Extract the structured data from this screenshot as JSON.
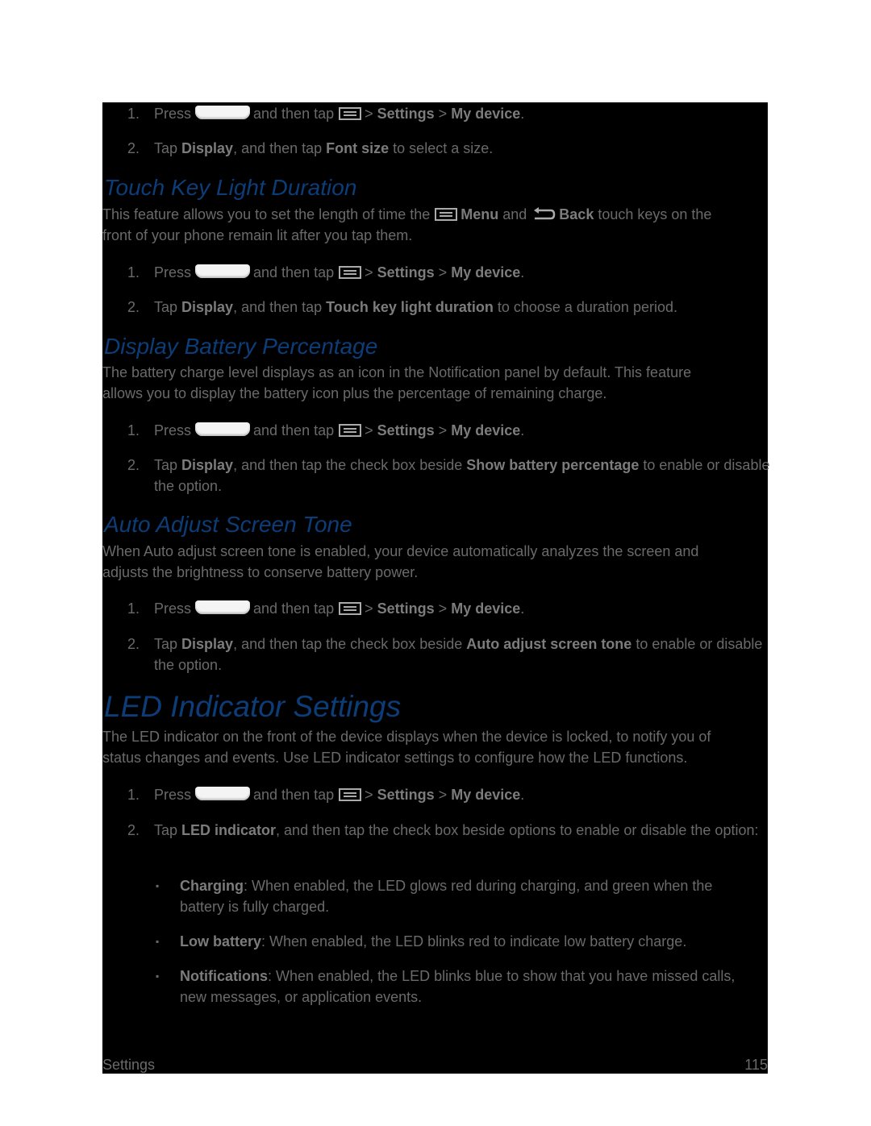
{
  "top_steps": {
    "s1": {
      "num": "1.",
      "press": "Press",
      "then": "and then tap",
      "gt1": ">",
      "settings": "Settings",
      "gt2": ">",
      "device": "My device",
      "end": "."
    },
    "s2": {
      "num": "2.",
      "a": "Tap ",
      "b1": "Display",
      "c": ", and then tap ",
      "b2": "Font size",
      "d": " to select a size."
    }
  },
  "touch_key": {
    "heading": "Touch Key Light Duration",
    "intro": {
      "a": "This feature allows you to set the length of time the",
      "menu": "Menu",
      "and": "and",
      "back": "Back",
      "b": "touch keys on the",
      "line2": "front of your phone remain lit after you tap them."
    },
    "s1": {
      "num": "1.",
      "press": "Press",
      "then": "and then tap",
      "gt1": ">",
      "settings": "Settings",
      "gt2": ">",
      "device": "My device",
      "end": "."
    },
    "s2": {
      "num": "2.",
      "a": "Tap ",
      "b1": "Display",
      "c": ", and then tap ",
      "b2": "Touch key light duration",
      "d": " to choose a duration period."
    }
  },
  "battery": {
    "heading": "Display Battery Percentage",
    "intro1": "The battery charge level displays as an icon in the Notification panel by default. This feature",
    "intro2": "allows you to display the battery icon plus the percentage of remaining charge.",
    "s1": {
      "num": "1.",
      "press": "Press",
      "then": "and then tap",
      "gt1": ">",
      "settings": "Settings",
      "gt2": ">",
      "device": "My device",
      "end": "."
    },
    "s2": {
      "num": "2.",
      "a": "Tap ",
      "b1": "Display",
      "c": ", and then tap the check box beside ",
      "b2": "Show battery percentage",
      "d": " to enable or disable the option."
    }
  },
  "tone": {
    "heading": "Auto Adjust Screen Tone",
    "intro1": "When Auto adjust screen tone is enabled, your device automatically analyzes the screen and",
    "intro2": "adjusts the brightness to conserve battery power.",
    "s1": {
      "num": "1.",
      "press": "Press",
      "then": "and then tap",
      "gt1": ">",
      "settings": "Settings",
      "gt2": ">",
      "device": "My device",
      "end": "."
    },
    "s2": {
      "num": "2.",
      "a": "Tap ",
      "b1": "Display",
      "c": ", and then tap the check box beside ",
      "b2": "Auto adjust screen tone",
      "d": " to enable or disable the option."
    }
  },
  "led": {
    "heading": "LED Indicator Settings",
    "intro1": "The LED indicator on the front of the device displays when the device is locked, to notify you of",
    "intro2": "status changes and events. Use LED indicator settings to configure how the LED functions.",
    "s1": {
      "num": "1.",
      "press": "Press",
      "then": "and then tap",
      "gt1": ">",
      "settings": "Settings",
      "gt2": ">",
      "device": "My device",
      "end": "."
    },
    "s2": {
      "num": "2.",
      "a": "Tap ",
      "b1": "LED indicator",
      "c": ", and then tap the check box beside options to enable or disable the option:"
    },
    "bullets": [
      {
        "mark": "▪",
        "label": "Charging",
        "text": ": When enabled, the LED glows red during charging, and green when the battery is fully charged."
      },
      {
        "mark": "▪",
        "label": "Low battery",
        "text": ": When enabled, the LED blinks red to indicate low battery charge."
      },
      {
        "mark": "▪",
        "label": "Notifications",
        "text": ": When enabled, the LED blinks blue to show that you have missed calls, new messages, or application events."
      }
    ]
  },
  "footer": {
    "section": "Settings",
    "page": "115"
  },
  "colors": {
    "heading": "#0c3d78",
    "body": "#6a6a6a",
    "bold": "#7c7c7c",
    "background": "#000000"
  }
}
